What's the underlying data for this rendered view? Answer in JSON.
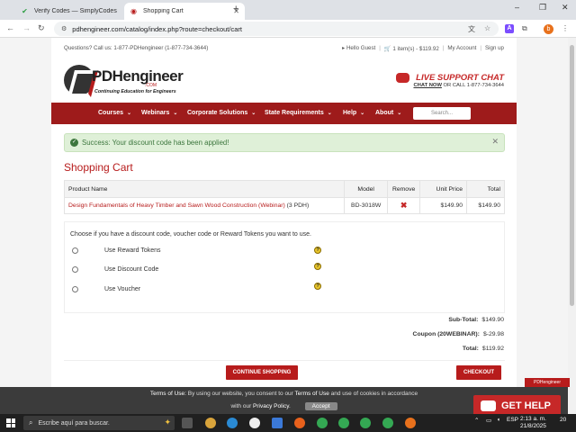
{
  "browser": {
    "tabs": [
      {
        "title": "Verify Codes — SimplyCodes",
        "active": false
      },
      {
        "title": "Shopping Cart",
        "active": true
      }
    ],
    "new_tab": "+",
    "url": "pdhengineer.com/catalog/index.php?route=checkout/cart",
    "window_controls": [
      "–",
      "❐",
      "✕"
    ],
    "profile_initial": "b",
    "extension_label": "A"
  },
  "site": {
    "topbar_left": "Questions? Call us: 1-877-PDHengineer (1-877-734-3644)",
    "topbar_right": [
      "Hello Guest",
      "1 item(s) - $119.92",
      "My Account",
      "Sign up"
    ],
    "logo": {
      "name": "PDHengineer",
      "com": ".COM",
      "tagline": "Continuing Education for Engineers"
    },
    "support": {
      "title": "LIVE SUPPORT CHAT",
      "chat_now": "CHAT NOW",
      "rest": " OR CALL 1-877-734-3644"
    },
    "nav": [
      "Courses",
      "Webinars",
      "Corporate Solutions",
      "State Requirements",
      "Help",
      "About"
    ],
    "search_placeholder": "Search..."
  },
  "alert": {
    "text": "Success: Your discount code has been applied!"
  },
  "page_title": "Shopping Cart",
  "cart": {
    "headers": [
      "Product Name",
      "Model",
      "Remove",
      "Unit Price",
      "Total"
    ],
    "rows": [
      {
        "product": "Design Fundamentals of Heavy Timber and Sawn Wood Construction (Webinar)",
        "suffix": " (3 PDH)",
        "model": "BD-3018W",
        "unit_price": "$149.90",
        "total": "$149.90"
      }
    ]
  },
  "discount": {
    "prompt": "Choose if you have a discount code, voucher code or Reward Tokens you want to use.",
    "options": [
      "Use Reward Tokens",
      "Use Discount Code",
      "Use Voucher"
    ]
  },
  "totals": [
    {
      "label": "Sub-Total:",
      "value": "$149.90"
    },
    {
      "label": "Coupon (20WEBINAR):",
      "value": "$-29.98"
    },
    {
      "label": "Total:",
      "value": "$119.92"
    }
  ],
  "actions": {
    "continue": "CONTINUE SHOPPING",
    "checkout": "CHECKOUT"
  },
  "cookie": {
    "terms_label": "Terms of Use:",
    "line1_a": "By using our website, you consent to our",
    "terms_link": "Terms of Use",
    "line1_b": "and use of cookies in accordance",
    "line2_a": "with our",
    "privacy_link": "Privacy Policy",
    "accept": "Accept"
  },
  "chat_widget": {
    "label": "GET HELP",
    "badge": "PDHengineer"
  },
  "taskbar": {
    "search_placeholder": "Escribe aquí para buscar.",
    "lang": "ESP",
    "time": "2:13 a. m.",
    "date": "21/8/2025",
    "notif": "20"
  }
}
